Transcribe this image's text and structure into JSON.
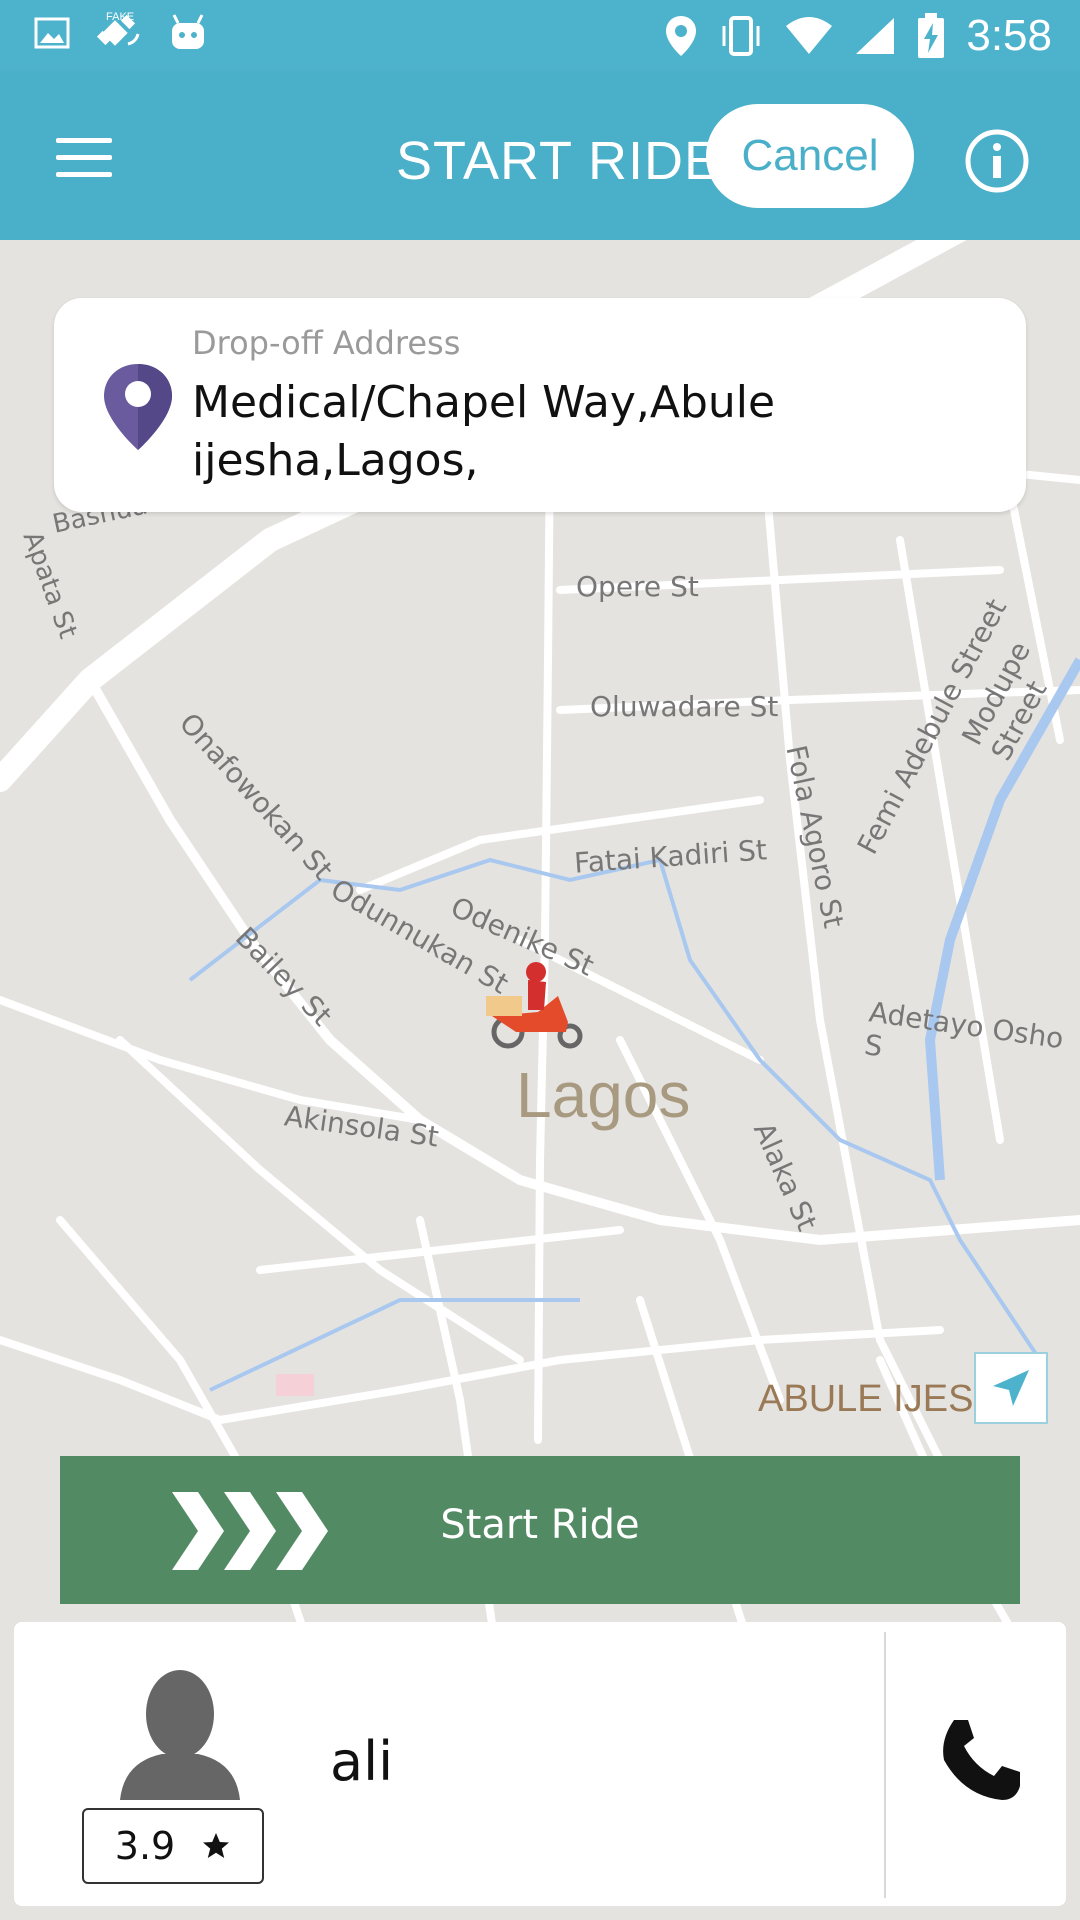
{
  "status_bar": {
    "time": "3:58"
  },
  "header": {
    "title": "START RIDE",
    "cancel_label": "Cancel"
  },
  "dropoff": {
    "label": "Drop-off Address",
    "address": "Medical/Chapel Way,Abule ijesha,Lagos,"
  },
  "map": {
    "city_label": "Lagos",
    "area_label": "ABULE IJESH",
    "street_labels": [
      "Bashua",
      "Apata St",
      "Opere St",
      "Oluwadare St",
      "Onafowokan St",
      "Fatai Kadiri St",
      "Fola Agoro St",
      "Femi Adebule Street",
      "Modupe Street",
      "Odunnukan St",
      "Odenike St",
      "Bailey St",
      "Adetayo Osho S",
      "Akinsola St",
      "Alaka St"
    ]
  },
  "start_ride": {
    "label": "Start Ride"
  },
  "driver": {
    "name": "ali",
    "rating": "3.9"
  },
  "colors": {
    "header": "#4aafc8",
    "start_ride": "#528a64",
    "pin": "#6a5a9e"
  },
  "icons": [
    "gallery-icon",
    "fake-gps-icon",
    "android-icon",
    "location-icon",
    "vibrate-icon",
    "wifi-icon",
    "signal-icon",
    "battery-icon",
    "menu-icon",
    "info-icon",
    "map-pin-icon",
    "navigation-arrow-icon",
    "chevrons-icon",
    "avatar-icon",
    "star-icon",
    "phone-icon"
  ]
}
